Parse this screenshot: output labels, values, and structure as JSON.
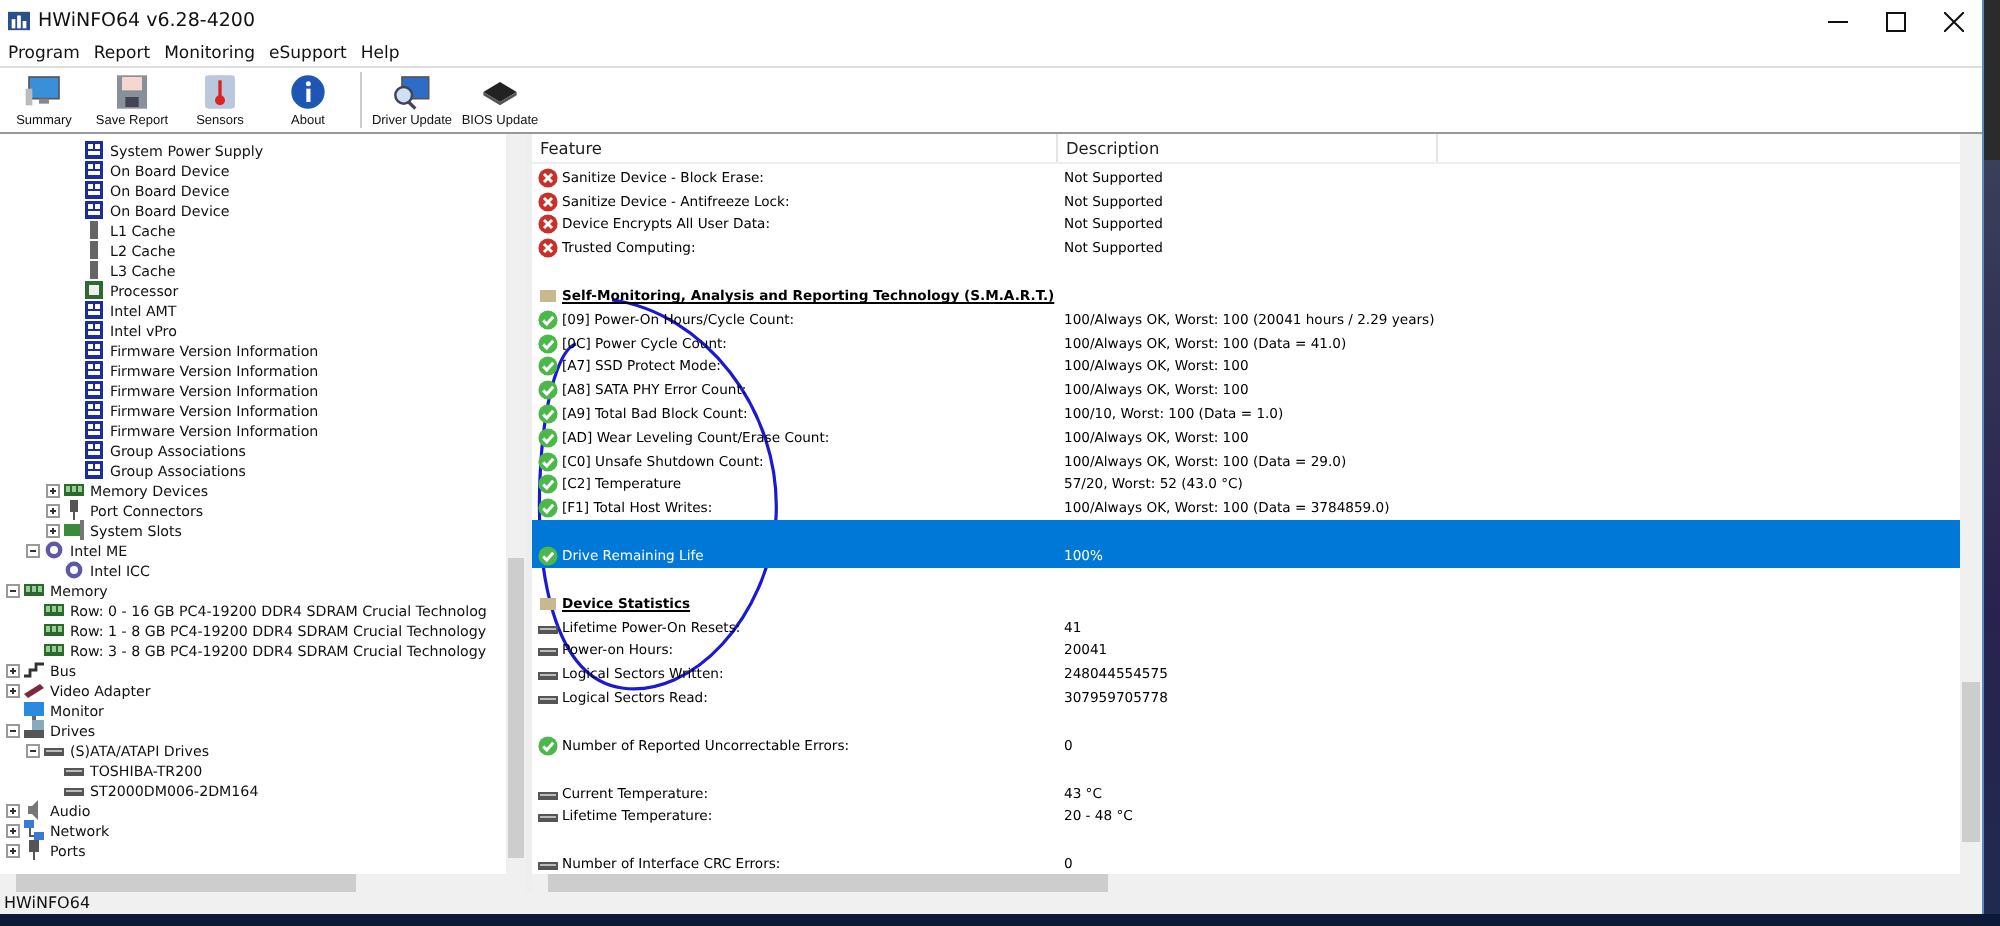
{
  "window": {
    "title": "HWiNFO64 v6.28-4200"
  },
  "menu": [
    "Program",
    "Report",
    "Monitoring",
    "eSupport",
    "Help"
  ],
  "toolbar": [
    {
      "label": "Summary",
      "kind": "summary",
      "separator_before": false
    },
    {
      "label": "Save Report",
      "kind": "save",
      "separator_before": false
    },
    {
      "label": "Sensors",
      "kind": "sensors",
      "separator_before": false
    },
    {
      "label": "About",
      "kind": "about",
      "separator_before": false
    },
    {
      "label": "Driver Update",
      "kind": "driver",
      "separator_before": true
    },
    {
      "label": "BIOS Update",
      "kind": "bios",
      "separator_before": false
    }
  ],
  "tree": [
    {
      "children": [
        {
          "children": [
            {
              "children": [
                {
                  "label": "System Power Supply",
                  "kind": "device"
                },
                {
                  "label": "On Board Device",
                  "kind": "device"
                },
                {
                  "label": "On Board Device",
                  "kind": "device"
                },
                {
                  "label": "On Board Device",
                  "kind": "device"
                },
                {
                  "label": "L1 Cache",
                  "kind": "cache"
                },
                {
                  "label": "L2 Cache",
                  "kind": "cache"
                },
                {
                  "label": "L3 Cache",
                  "kind": "cache"
                },
                {
                  "label": "Processor",
                  "kind": "cpu"
                },
                {
                  "label": "Intel AMT",
                  "kind": "device"
                },
                {
                  "label": "Intel vPro",
                  "kind": "device"
                },
                {
                  "label": "Firmware Version Information",
                  "kind": "device"
                },
                {
                  "label": "Firmware Version Information",
                  "kind": "device"
                },
                {
                  "label": "Firmware Version Information",
                  "kind": "device"
                },
                {
                  "label": "Firmware Version Information",
                  "kind": "device"
                },
                {
                  "label": "Firmware Version Information",
                  "kind": "device"
                },
                {
                  "label": "Group Associations",
                  "kind": "device"
                },
                {
                  "label": "Group Associations",
                  "kind": "device"
                }
              ]
            },
            {
              "label": "Memory Devices",
              "kind": "memory",
              "expanded": false
            },
            {
              "label": "Port Connectors",
              "kind": "port",
              "expanded": false
            },
            {
              "label": "System Slots",
              "kind": "slot",
              "expanded": false
            }
          ]
        },
        {
          "label": "Intel ME",
          "kind": "gear",
          "expanded": true,
          "children": [
            {
              "label": "Intel ICC",
              "kind": "gear"
            }
          ]
        }
      ]
    },
    {
      "label": "Memory",
      "kind": "memory",
      "expanded": true,
      "children": [
        {
          "label": "Row: 0 - 16 GB PC4-19200 DDR4 SDRAM Crucial Technolog",
          "kind": "memory"
        },
        {
          "label": "Row: 1 - 8 GB PC4-19200 DDR4 SDRAM Crucial Technology",
          "kind": "memory"
        },
        {
          "label": "Row: 3 - 8 GB PC4-19200 DDR4 SDRAM Crucial Technology",
          "kind": "memory"
        }
      ]
    },
    {
      "label": "Bus",
      "kind": "bus",
      "expanded": false
    },
    {
      "label": "Video Adapter",
      "kind": "video",
      "expanded": false
    },
    {
      "label": "Monitor",
      "kind": "monitor"
    },
    {
      "label": "Drives",
      "kind": "drive",
      "expanded": true,
      "children": [
        {
          "label": "(S)ATA/ATAPI Drives",
          "kind": "disk",
          "expanded": true,
          "children": [
            {
              "label": "TOSHIBA-TR200",
              "kind": "disk"
            },
            {
              "label": "ST2000DM006-2DM164",
              "kind": "disk"
            }
          ]
        }
      ]
    },
    {
      "label": "Audio",
      "kind": "audio",
      "expanded": false
    },
    {
      "label": "Network",
      "kind": "network",
      "expanded": false
    },
    {
      "label": "Ports",
      "kind": "usb",
      "expanded": false
    }
  ],
  "table": {
    "columns": [
      "Feature",
      "Description"
    ],
    "rows": [
      {
        "kind": "error",
        "feature": "Sanitize Device - Block Erase:",
        "description": "Not Supported",
        "selected": false,
        "gap_before": false
      },
      {
        "kind": "error",
        "feature": "Sanitize Device - Antifreeze Lock:",
        "description": "Not Supported",
        "selected": false,
        "gap_before": false
      },
      {
        "kind": "error",
        "feature": "Device Encrypts All User Data:",
        "description": "Not Supported",
        "selected": false,
        "gap_before": false
      },
      {
        "kind": "error",
        "feature": "Trusted Computing:",
        "description": "Not Supported",
        "selected": false,
        "gap_before": false
      },
      {
        "kind": "section",
        "feature": "Self-Monitoring, Analysis and Reporting Technology (S.M.A.R.T.)",
        "selected": false,
        "gap_before": true
      },
      {
        "kind": "ok",
        "feature": "[09] Power-On Hours/Cycle Count:",
        "description": "100/Always OK, Worst: 100 (20041 hours / 2.29 years)",
        "selected": false,
        "gap_before": false
      },
      {
        "kind": "ok",
        "feature": "[0C] Power Cycle Count:",
        "description": "100/Always OK, Worst: 100 (Data = 41.0)",
        "selected": false,
        "gap_before": false
      },
      {
        "kind": "ok",
        "feature": "[A7] SSD Protect Mode:",
        "description": "100/Always OK, Worst: 100",
        "selected": false,
        "gap_before": false
      },
      {
        "kind": "ok",
        "feature": "[A8] SATA PHY Error Count:",
        "description": "100/Always OK, Worst: 100",
        "selected": false,
        "gap_before": false
      },
      {
        "kind": "ok",
        "feature": "[A9] Total Bad Block Count:",
        "description": "100/10, Worst: 100 (Data = 1.0)",
        "selected": false,
        "gap_before": false
      },
      {
        "kind": "ok",
        "feature": "[AD] Wear Leveling Count/Erase Count:",
        "description": "100/Always OK, Worst: 100",
        "selected": false,
        "gap_before": false
      },
      {
        "kind": "ok",
        "feature": "[C0] Unsafe Shutdown Count:",
        "description": "100/Always OK, Worst: 100 (Data = 29.0)",
        "selected": false,
        "gap_before": false
      },
      {
        "kind": "ok",
        "feature": "[C2] Temperature",
        "description": "57/20, Worst: 52 (43.0 °C)",
        "selected": false,
        "gap_before": false
      },
      {
        "kind": "ok",
        "feature": "[F1] Total Host Writes:",
        "description": "100/Always OK, Worst: 100 (Data = 3784859.0)",
        "selected": false,
        "gap_before": false
      },
      {
        "kind": "ok",
        "feature": "Drive Remaining Life",
        "description": "100%",
        "selected": true,
        "gap_before": true
      },
      {
        "kind": "section",
        "feature": "Device Statistics",
        "selected": false,
        "gap_before": true
      },
      {
        "kind": "disk",
        "feature": "Lifetime Power-On Resets:",
        "description": "41",
        "selected": false,
        "gap_before": false
      },
      {
        "kind": "disk",
        "feature": "Power-on Hours:",
        "description": "20041",
        "selected": false,
        "gap_before": false
      },
      {
        "kind": "disk",
        "feature": "Logical Sectors Written:",
        "description": "248044554575",
        "selected": false,
        "gap_before": false
      },
      {
        "kind": "disk",
        "feature": "Logical Sectors Read:",
        "description": "307959705778",
        "selected": false,
        "gap_before": false
      },
      {
        "kind": "ok",
        "feature": "Number of Reported Uncorrectable Errors:",
        "description": "0",
        "selected": false,
        "gap_before": true
      },
      {
        "kind": "disk",
        "feature": "Current Temperature:",
        "description": "43 °C",
        "selected": false,
        "gap_before": true
      },
      {
        "kind": "disk",
        "feature": "Lifetime Temperature:",
        "description": "20 - 48 °C",
        "selected": false,
        "gap_before": false
      },
      {
        "kind": "disk",
        "feature": "Number of Interface CRC Errors:",
        "description": "0",
        "selected": false,
        "gap_before": true
      }
    ]
  },
  "status_bar": "HWiNFO64"
}
